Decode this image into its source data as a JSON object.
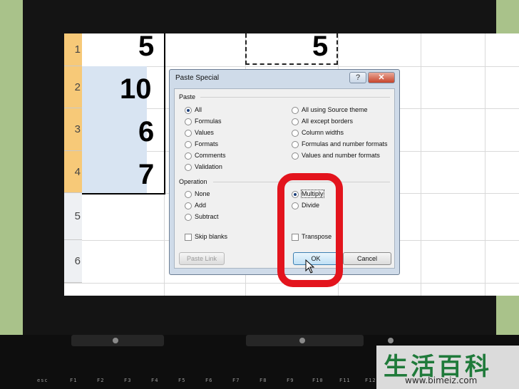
{
  "spreadsheet": {
    "row_headers": [
      "1",
      "2",
      "3",
      "4",
      "5",
      "6"
    ],
    "column_a_values": [
      "5",
      "10",
      "6",
      "7"
    ],
    "copied_cell_value": "5"
  },
  "dialog": {
    "title": "Paste Special",
    "help_label": "?",
    "close_label": "✕",
    "paste_section": "Paste",
    "paste_options_left": [
      "All",
      "Formulas",
      "Values",
      "Formats",
      "Comments",
      "Validation"
    ],
    "paste_options_right": [
      "All using Source theme",
      "All except borders",
      "Column widths",
      "Formulas and number formats",
      "Values and number formats"
    ],
    "paste_selected": "All",
    "operation_section": "Operation",
    "operation_options_left": [
      "None",
      "Add",
      "Subtract"
    ],
    "operation_options_right": [
      "Multiply",
      "Divide"
    ],
    "operation_selected": "Multiply",
    "skip_blanks_label": "Skip blanks",
    "transpose_label": "Transpose",
    "paste_link_label": "Paste Link",
    "ok_label": "OK",
    "cancel_label": "Cancel"
  },
  "keyboard": {
    "keys": [
      "esc",
      "F1",
      "F2",
      "F3",
      "F4",
      "F5",
      "F6",
      "F7",
      "F8",
      "F9",
      "F10",
      "F11",
      "F12"
    ]
  },
  "watermark": {
    "characters": "生活百科",
    "url": "www.bimeiz.com"
  },
  "colors": {
    "highlight_ring": "#e3141d",
    "selected_row_header": "#f7c978",
    "background": "#a9c28a"
  }
}
